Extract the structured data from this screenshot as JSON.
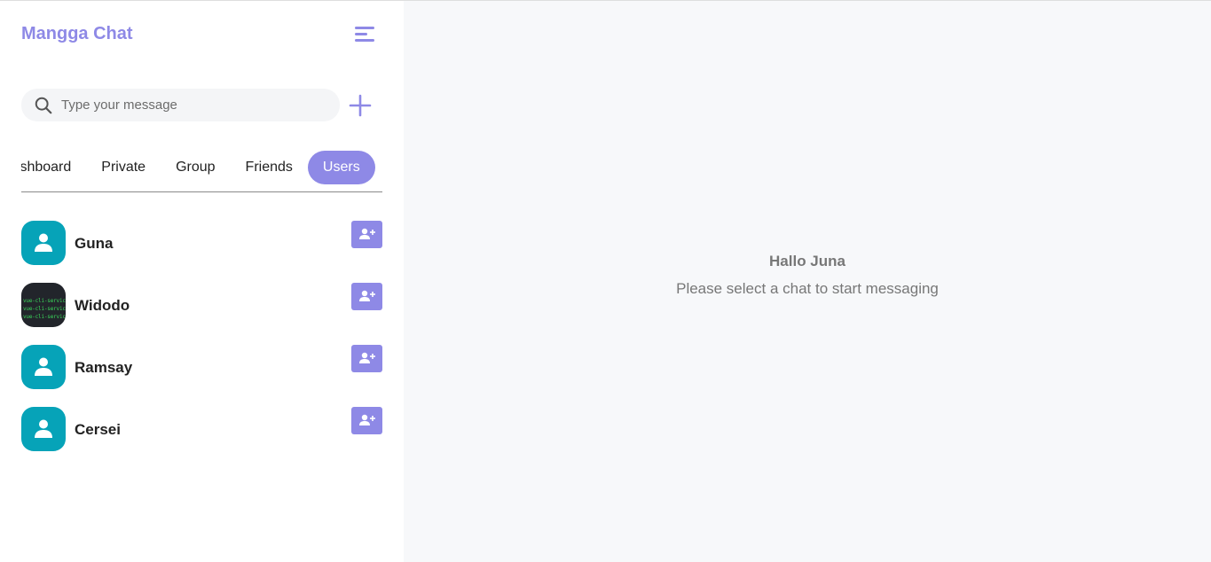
{
  "app": {
    "title": "Mangga Chat"
  },
  "search": {
    "placeholder": "Type your message"
  },
  "tabs": [
    {
      "label": "Dashboard"
    },
    {
      "label": "Private"
    },
    {
      "label": "Group"
    },
    {
      "label": "Friends"
    },
    {
      "label": "Users",
      "active": true
    }
  ],
  "users": [
    {
      "name": "Guna",
      "avatar": "default-user-icon"
    },
    {
      "name": "Widodo",
      "avatar": "terminal-screenshot-photo",
      "avatar_text": [
        "vue-cli-servic",
        "vue-cli-servic",
        "vue-cli-servic"
      ]
    },
    {
      "name": "Ramsay",
      "avatar": "default-user-icon"
    },
    {
      "name": "Cersei",
      "avatar": "default-user-icon"
    }
  ],
  "main": {
    "greeting": "Hallo Juna",
    "prompt": "Please select a chat to start messaging"
  },
  "colors": {
    "accent": "#8e89e6",
    "avatar_bg": "#06a3b8",
    "main_bg": "#f7f8fa"
  }
}
